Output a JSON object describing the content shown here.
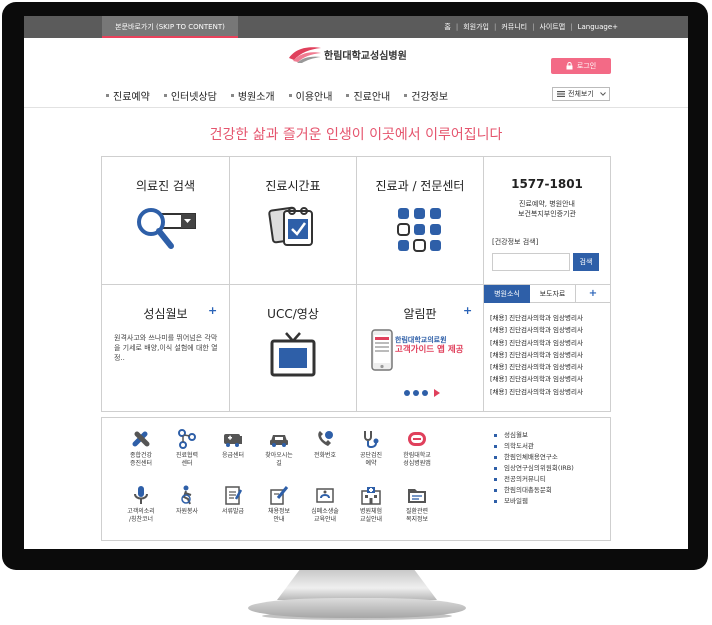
{
  "topbar": {
    "skip_label": "본문바로가기 (SKIP TO CONTENT)",
    "util": [
      "홈",
      "회원가입",
      "커뮤니티",
      "사이트맵",
      "Language+"
    ]
  },
  "header": {
    "logo_text": "한림대학교성심병원",
    "login_label": "로그인",
    "menu": [
      "진료예약",
      "인터넷상담",
      "병원소개",
      "이용안내",
      "진료안내",
      "건강정보"
    ],
    "viewall_label": "전체보기"
  },
  "slogan": "건강한 삶과 즐거운 인생이 이곳에서 이루어집니다",
  "grid": {
    "doctor_search": "의료진 검색",
    "schedule": "진료시간표",
    "departments": "진료과 / 전문센터",
    "phone": "1577-1801",
    "phone_sub1": "진료예약, 병원안내",
    "phone_sub2": "보건복지부인증기관",
    "health_search_label": "[건강정보 검색]",
    "health_search_button": "검색",
    "magazine": "성심월보",
    "magazine_text": "원격사고와 쓰나미를 뛰어넘은 각막을 기세로 배양,이식 설험에 대한 열정..",
    "ucc": "UCC/영상",
    "notice": "알림판",
    "banner_line1": "한림대학교의료원",
    "banner_line2": "고객가이드 앱 제공",
    "news_tab_active": "병원소식",
    "news_tab": "보도자료",
    "news_items": [
      "[채용] 진단검사의학과 임상병리사",
      "[채용] 진단검사의학과 임상병리사",
      "[채용] 진단검사의학과 임상병리사",
      "[채용] 진단검사의학과 임상병리사",
      "[채용] 진단검사의학과 임상병리사",
      "[채용] 진단검사의학과 임상병리사",
      "[채용] 진단검사의학과 임상병리사"
    ]
  },
  "quick": {
    "row1": [
      {
        "label": "종합건강\n증진센터",
        "icon": "health-center-icon"
      },
      {
        "label": "진료협력\n센터",
        "icon": "network-icon"
      },
      {
        "label": "응급센터",
        "icon": "ambulance-icon"
      },
      {
        "label": "찾아오시는\n길",
        "icon": "car-icon"
      },
      {
        "label": "전화번호",
        "icon": "phone-icon"
      },
      {
        "label": "공단검진\n예약",
        "icon": "stethoscope-icon"
      },
      {
        "label": "한림대학교\n성심병원앱",
        "icon": "app-icon"
      }
    ],
    "row2": [
      {
        "label": "고객의소리\n/칭찬코너",
        "icon": "microphone-icon"
      },
      {
        "label": "자원봉사",
        "icon": "volunteer-icon"
      },
      {
        "label": "서류발급",
        "icon": "document-icon"
      },
      {
        "label": "채용정보\n안내",
        "icon": "recruit-icon"
      },
      {
        "label": "심폐소생술\n교육안내",
        "icon": "cpr-icon"
      },
      {
        "label": "병원체험\n교실안내",
        "icon": "hospital-icon"
      },
      {
        "label": "질환관련\n복지정보",
        "icon": "folder-icon"
      }
    ],
    "links": [
      "성심월보",
      "의학도서관",
      "한림인체배용연구소",
      "임상연구심의위원회(IRB)",
      "전공의커뮤니티",
      "한림의대총동문회",
      "모바일웹"
    ]
  },
  "colors": {
    "accent_pink": "#e5556e",
    "accent_blue": "#2e5fa8",
    "login_pink": "#f36a86"
  }
}
